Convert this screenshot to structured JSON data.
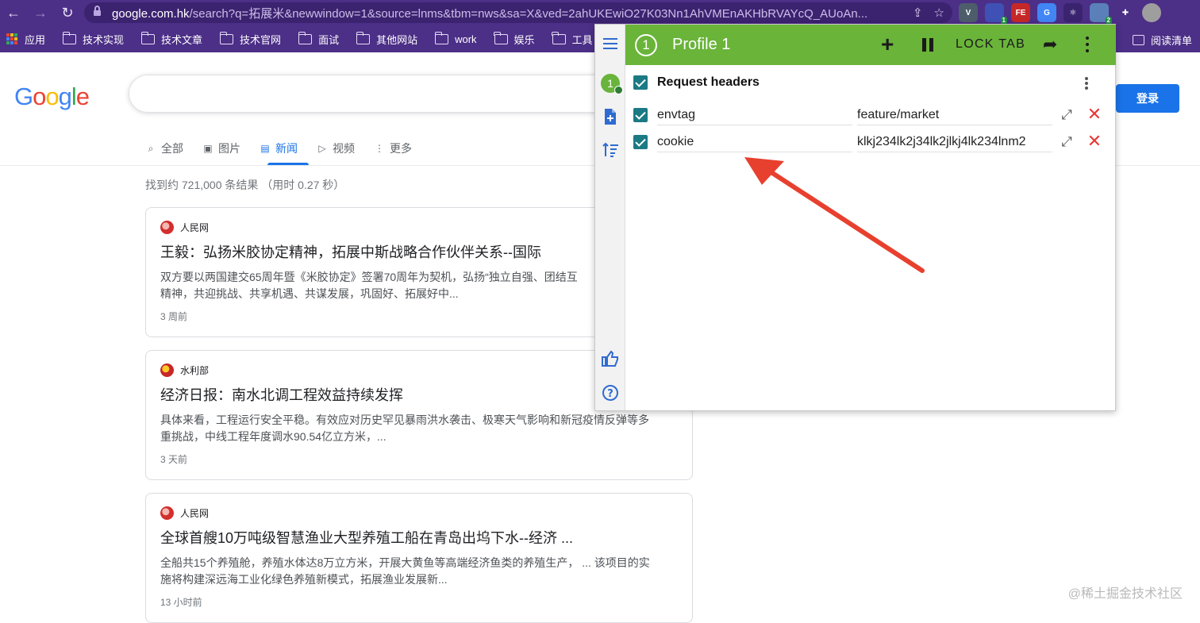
{
  "browser": {
    "url_host": "google.com.hk",
    "url_rest": "/search?q=拓展米&newwindow=1&source=lnms&tbm=nws&sa=X&ved=2ahUKEwiO27K03Nn1AhVMEnAKHbRVAYcQ_AUoAn...",
    "bookmarks": [
      "应用",
      "技术实现",
      "技术文章",
      "技术官网",
      "面试",
      "其他网站",
      "work",
      "娱乐",
      "工具"
    ],
    "reading_list": "阅读清单",
    "extensions": [
      {
        "name": "vue-devtools-icon",
        "color": "#4d5d6b",
        "label": "V"
      },
      {
        "name": "extension-badge-icon",
        "color": "#3f51b5",
        "label": "",
        "badge": "1"
      },
      {
        "name": "fe-helper-icon",
        "color": "#c62828",
        "label": "FE"
      },
      {
        "name": "translate-icon",
        "color": "#4285f4",
        "label": "G"
      },
      {
        "name": "react-devtools-icon",
        "color": "#3a2470",
        "label": "⚛"
      },
      {
        "name": "modheader-icon",
        "color": "#5b7fb8",
        "label": "",
        "badge": "2"
      },
      {
        "name": "extensions-puzzle-icon",
        "color": "#4c2f87",
        "label": "✚"
      },
      {
        "name": "profile-avatar",
        "color": "#9e9e9e",
        "label": ""
      }
    ]
  },
  "google": {
    "login": "登录",
    "tabs": [
      {
        "icon": "⌕",
        "label": "全部"
      },
      {
        "icon": "▣",
        "label": "图片"
      },
      {
        "icon": "▤",
        "label": "新闻"
      },
      {
        "icon": "▷",
        "label": "视频"
      },
      {
        "icon": "⋮",
        "label": "更多"
      }
    ],
    "result_stats": "找到约 721,000 条结果  （用时 0.27 秒）",
    "results": [
      {
        "source": "人民网",
        "title": "王毅：弘扬米胶协定精神，拓展中斯战略合作伙伴关系--国际",
        "snippet": "双方要以两国建交65周年暨《米胶协定》签署70周年为契机，弘扬“独立自强、团结互\n精神，共迎挑战、共享机遇、共谋发展，巩固好、拓展好中...",
        "time": "3 周前"
      },
      {
        "source": "水利部",
        "title": "经济日报：南水北调工程效益持续发挥",
        "snippet": "具体来看，工程运行安全平稳。有效应对历史罕见暴雨洪水袭击、极寒天气影响和新冠疫情反弹等多\n重挑战，中线工程年度调水90.54亿立方米，...",
        "time": "3 天前"
      },
      {
        "source": "人民网",
        "title": "全球首艘10万吨级智慧渔业大型养殖工船在青岛出坞下水--经济 ...",
        "snippet": "全船共15个养殖舱，养殖水体达8万立方米，开展大黄鱼等高端经济鱼类的养殖生产， ... 该项目的实\n施将构建深远海工业化绿色养殖新模式，拓展渔业发展新...",
        "time": "13 小时前"
      }
    ],
    "watermark": "@稀土掘金技术社区"
  },
  "popup": {
    "profile_number": "1",
    "profile_name": "Profile 1",
    "lock_tab": "LOCK TAB",
    "section_title": "Request headers",
    "headers": [
      {
        "name": "envtag",
        "value": "feature/market",
        "enabled": true
      },
      {
        "name": "cookie",
        "value": "klkj234lk2j34lk2jlkj4lk234lnm2",
        "enabled": true
      }
    ],
    "accent_color": "#6ab43a",
    "checkbox_color": "#1b7a84",
    "annotation_arrow_color": "#e8402e"
  }
}
